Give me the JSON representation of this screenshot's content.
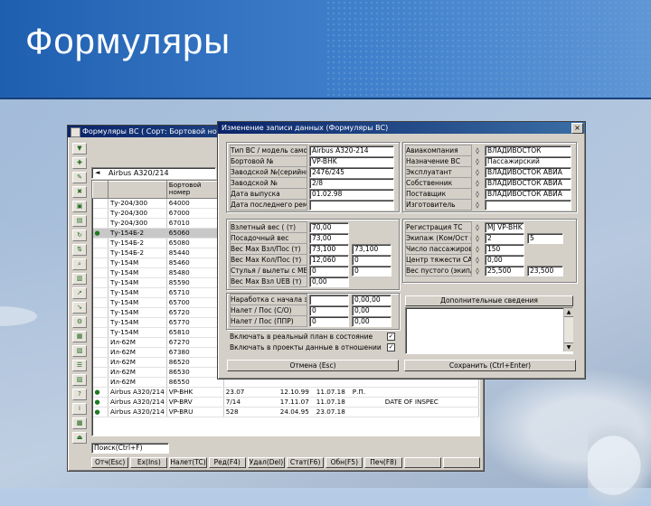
{
  "slide": {
    "title": "Формуляры"
  },
  "back_window": {
    "title": "Формуляры ВС ( Сорт: Бортовой номер )",
    "filter_value": "Airbus A320/214",
    "columns": [
      "",
      "",
      "Бортовой номер"
    ],
    "rows": [
      [
        "",
        "Ту-204/300",
        "64000"
      ],
      [
        "",
        "Ту-204/300",
        "67000"
      ],
      [
        "",
        "Ту-204/300",
        "67010"
      ],
      [
        "",
        "Ту-154Б-2",
        "65060"
      ],
      [
        "",
        "Ту-154Б-2",
        "65080"
      ],
      [
        "",
        "Ту-154Б-2",
        "85440"
      ],
      [
        "",
        "Ту-154М",
        "85460"
      ],
      [
        "",
        "Ту-154М",
        "85480"
      ],
      [
        "",
        "Ту-154М",
        "85590"
      ],
      [
        "",
        "Ту-154М",
        "65710"
      ],
      [
        "",
        "Ту-154М",
        "65700"
      ],
      [
        "",
        "Ту-154М",
        "65720"
      ],
      [
        "",
        "Ту-154М",
        "65770"
      ],
      [
        "",
        "Ту-154М",
        "65810"
      ],
      [
        "",
        "Ил-62М",
        "67270"
      ],
      [
        "",
        "Ил-62М",
        "67380"
      ],
      [
        "",
        "Ил-62М",
        "86520"
      ],
      [
        "",
        "Ил-62М",
        "86530"
      ],
      [
        "",
        "Ил-62М",
        "86550"
      ],
      [
        "",
        "Airbus A320/214",
        "VP-BHK"
      ],
      [
        "",
        "Airbus A320/214",
        "VP-BRV"
      ],
      [
        "",
        "Airbus A320/214",
        "VP-BRU"
      ]
    ],
    "extra_columns": [
      [
        "23.07",
        "12.10.99",
        "11.07.18",
        "Р.П.",
        ""
      ],
      [
        "7/14",
        "17.11.07",
        "11.07.18",
        "",
        "DATE OF INSPEC"
      ],
      [
        "528",
        "24.04.95",
        "23.07.18",
        "",
        ""
      ]
    ],
    "search_label": "Поиск(Ctrl+F)",
    "bottom_buttons": [
      "Отч(Esc)",
      "Ех(Ins)",
      "Налет(TC)",
      "Ред(F4)",
      "Удал(Del)",
      "Стат(F6)",
      "Обн(F5)",
      "Печ(F8)",
      "",
      ""
    ]
  },
  "dialog": {
    "title": "Изменение записи данных (Формуляры ВС)",
    "left_fields": [
      {
        "label": "Тип ВС / модель самолета",
        "value": "Airbus A320-214"
      },
      {
        "label": "Бортовой №",
        "value": "VP-BHK"
      },
      {
        "label": "Заводской №(серийный)",
        "value": "2476/245"
      },
      {
        "label": "Заводской №",
        "value": "2/8"
      },
      {
        "label": "Дата выпуска",
        "value": "01.02.98"
      },
      {
        "label": "Дата последнего ремонта",
        "value": ""
      }
    ],
    "weight_fields": [
      {
        "label": "Взлетный вес ( (т)",
        "value": "70,00"
      },
      {
        "label": "Посадочный вес",
        "value": "73,00"
      },
      {
        "label": "Вес Мах Взл/Пос (т)",
        "value": "73,100",
        "value2": "73,100"
      },
      {
        "label": "Вес Мах Кол/Пос (т)",
        "value": "12,060",
        "value2": "0"
      },
      {
        "label": "Стулья / вылеты с МВР",
        "value": "0",
        "value2": "0"
      },
      {
        "label": "Вес Мах Взл UEB (т)",
        "value": "0,00"
      }
    ],
    "hours_fields": [
      {
        "label": "Наработка с начала экспл.",
        "value": "",
        "value2": "0,00,00"
      },
      {
        "label": "Налет / Пос (С/О)",
        "value": "0",
        "value2": "0,00"
      },
      {
        "label": "Налет / Пос (ППР)",
        "value": "0",
        "value2": "0,00"
      }
    ],
    "checkboxes": [
      {
        "label": "Включать в реальный план в состояние",
        "checked": true
      },
      {
        "label": "Включать в проекты данные в отношении",
        "checked": true
      }
    ],
    "right_fields": [
      {
        "label": "Авиакомпания",
        "value": "ВЛАДИВОСТОК"
      },
      {
        "label": "Назначение ВС",
        "value": "Пассажирский"
      },
      {
        "label": "Эксплуатант",
        "value": "ВЛАДИВОСТОК АВИА"
      },
      {
        "label": "Собственник",
        "value": "ВЛАДИВОСТОК АВИА"
      },
      {
        "label": "Поставщик",
        "value": "ВЛАДИВОСТОК АВИА"
      },
      {
        "label": "Изготовитель",
        "value": ""
      }
    ],
    "right_fields2": [
      {
        "label": "Регистрация ТС",
        "value": "MJ VP-BHK"
      },
      {
        "label": "Экипаж (Ком/Ост пол.)",
        "value": "2",
        "value2": "5"
      },
      {
        "label": "Число пассажиров (эк)",
        "value": "150"
      },
      {
        "label": "Центр тяжести САХ",
        "value": "0,00"
      },
      {
        "label": "Вес пустого (экип/пол.)",
        "value": "25,500",
        "value2": "23,500"
      }
    ],
    "extra_info_button": "Дополнительные сведения",
    "cancel_button": "Отмена (Esc)",
    "save_button": "Сохранить (Ctrl+Enter)"
  }
}
